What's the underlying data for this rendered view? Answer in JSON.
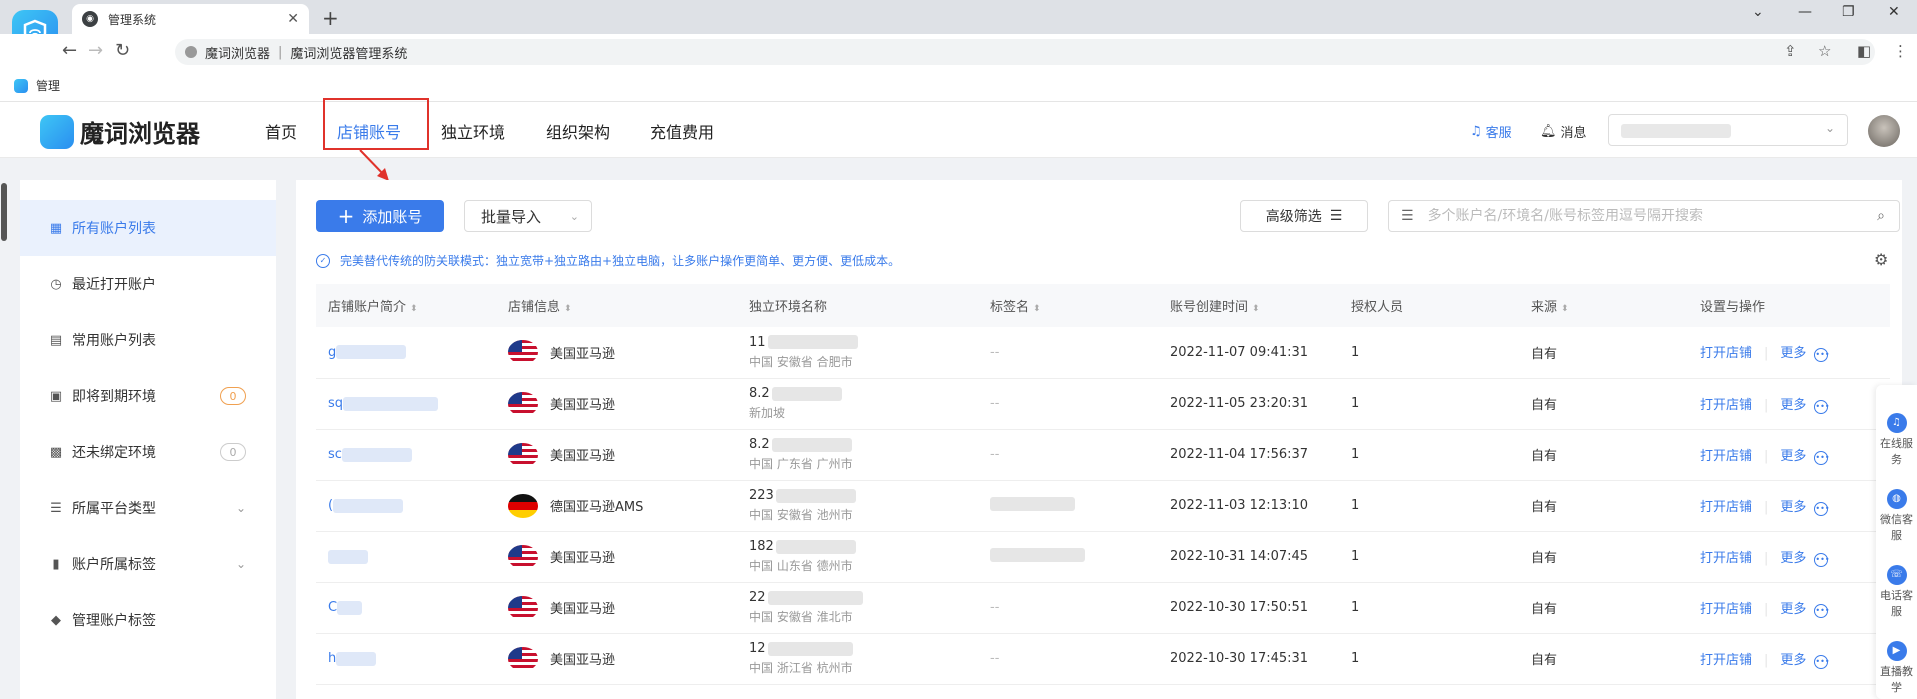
{
  "browser": {
    "tab_title": "管理系统",
    "omnibox_site": "魔词浏览器",
    "omnibox_title": "魔词浏览器管理系统",
    "bookmark": "管理"
  },
  "header": {
    "logo_text": "魔词浏览器",
    "nav": [
      "首页",
      "店铺账号",
      "独立环境",
      "组织架构",
      "充值费用"
    ],
    "support": "客服",
    "messages": "消息"
  },
  "sidebar": {
    "items": [
      {
        "label": "所有账户列表"
      },
      {
        "label": "最近打开账户"
      },
      {
        "label": "常用账户列表"
      },
      {
        "label": "即将到期环境",
        "badge": "0"
      },
      {
        "label": "还未绑定环境",
        "badge": "0"
      },
      {
        "label": "所属平台类型"
      },
      {
        "label": "账户所属标签"
      },
      {
        "label": "管理账户标签"
      }
    ]
  },
  "toolbar": {
    "add_label": "添加账号",
    "import_label": "批量导入",
    "filter_label": "高级筛选",
    "search_placeholder": "多个账户名/环境名/账号标签用逗号隔开搜索",
    "notice": "完美替代传统的防关联模式：独立宽带+独立路由+独立电脑，让多账户操作更简单、更方便、更低成本。"
  },
  "table": {
    "headers": [
      "店铺账户简介",
      "店铺信息",
      "独立环境名称",
      "标签名",
      "账号创建时间",
      "授权人员",
      "来源",
      "设置与操作"
    ],
    "rows": [
      {
        "name": "g",
        "store": "美国亚马逊",
        "env1": "11",
        "env2": "中国 安徽省 合肥市",
        "tag": "--",
        "created": "2022-11-07 09:41:31",
        "auth": "1",
        "source": "自有"
      },
      {
        "name": "sq",
        "store": "美国亚马逊",
        "env1": "8.2",
        "env2": "新加坡",
        "tag": "--",
        "created": "2022-11-05 23:20:31",
        "auth": "1",
        "source": "自有"
      },
      {
        "name": "sc",
        "store": "美国亚马逊",
        "env1": "8.2",
        "env2": "中国 广东省 广州市",
        "tag": "--",
        "created": "2022-11-04 17:56:37",
        "auth": "1",
        "source": "自有"
      },
      {
        "name": "(",
        "store": "德国亚马逊AMS",
        "env1": "223",
        "env2": "中国 安徽省 池州市",
        "tag": "",
        "created": "2022-11-03 12:13:10",
        "auth": "1",
        "source": "自有"
      },
      {
        "name": "",
        "store": "美国亚马逊",
        "env1": "182",
        "env2": "中国 山东省 德州市",
        "tag": "",
        "created": "2022-10-31 14:07:45",
        "auth": "1",
        "source": "自有"
      },
      {
        "name": "C",
        "store": "美国亚马逊",
        "env1": "22",
        "env2": "中国 安徽省 淮北市",
        "tag": "--",
        "created": "2022-10-30 17:50:51",
        "auth": "1",
        "source": "自有"
      },
      {
        "name": "h",
        "store": "美国亚马逊",
        "env1": "12",
        "env2": "中国 浙江省 杭州市",
        "tag": "--",
        "created": "2022-10-30 17:45:31",
        "auth": "1",
        "source": "自有"
      }
    ],
    "open_label": "打开店铺",
    "more_label": "更多"
  },
  "service": {
    "items": [
      "在线服务",
      "微信客服",
      "电话客服",
      "直播教学"
    ]
  },
  "colors": {
    "accent": "#3a7bea",
    "highlight": "#e0322b"
  }
}
